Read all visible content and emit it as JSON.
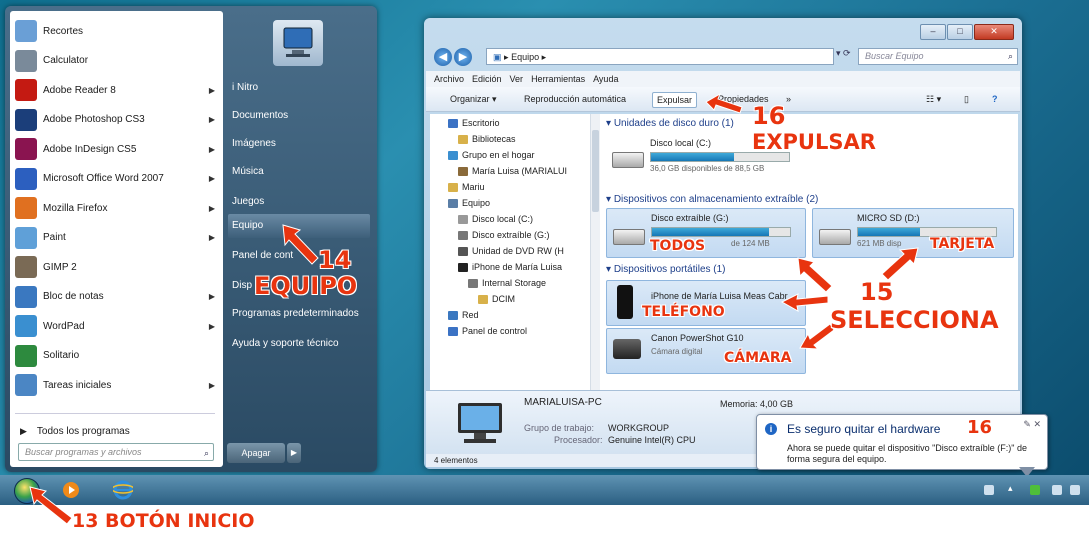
{
  "start_menu": {
    "programs": [
      {
        "label": "Recortes",
        "icon": "scissors-icon",
        "color": "#6a9fd6",
        "arrow": false
      },
      {
        "label": "Calculator",
        "icon": "calculator-icon",
        "color": "#7a8a9a",
        "arrow": false
      },
      {
        "label": "Adobe Reader 8",
        "icon": "adobe-reader-icon",
        "color": "#c41a12",
        "arrow": true
      },
      {
        "label": "Adobe Photoshop CS3",
        "icon": "photoshop-icon",
        "color": "#1b3e7a",
        "arrow": true
      },
      {
        "label": "Adobe InDesign CS5",
        "icon": "indesign-icon",
        "color": "#8a1450",
        "arrow": true
      },
      {
        "label": "Microsoft Office Word 2007",
        "icon": "word-icon",
        "color": "#2c5fbf",
        "arrow": true
      },
      {
        "label": "Mozilla Firefox",
        "icon": "firefox-icon",
        "color": "#e07020",
        "arrow": true
      },
      {
        "label": "Paint",
        "icon": "paint-icon",
        "color": "#5fa0d8",
        "arrow": true
      },
      {
        "label": "GIMP 2",
        "icon": "gimp-icon",
        "color": "#7a6a55",
        "arrow": false
      },
      {
        "label": "Bloc de notas",
        "icon": "notepad-icon",
        "color": "#3a78c0",
        "arrow": true
      },
      {
        "label": "WordPad",
        "icon": "wordpad-icon",
        "color": "#3a8fd0",
        "arrow": true
      },
      {
        "label": "Solitario",
        "icon": "solitaire-icon",
        "color": "#2d8a3e",
        "arrow": false
      },
      {
        "label": "Tareas iniciales",
        "icon": "getting-started-icon",
        "color": "#4b86c4",
        "arrow": true
      }
    ],
    "all_programs": "Todos los programas",
    "search_placeholder": "Buscar programas y archivos",
    "right_items": [
      "i Nitro",
      "Documentos",
      "Imágenes",
      "Música",
      "Juegos",
      "Equipo",
      "Panel de control",
      "Dispositivos e impresoras",
      "Programas predeterminados",
      "Ayuda y soporte técnico"
    ],
    "right_items_visible": [
      "i Nitro",
      "Documentos",
      "Imágenes",
      "Música",
      "Juegos",
      "Equipo",
      "Panel de cont",
      "Disp",
      "Programas predeterminados",
      "Ayuda y soporte técnico"
    ],
    "selected_right_index": 5,
    "shutdown_label": "Apagar"
  },
  "explorer": {
    "address": "Equipo",
    "search_placeholder": "Buscar Equipo",
    "menu": [
      "Archivo",
      "Edición",
      "Ver",
      "Herramientas",
      "Ayuda"
    ],
    "toolbar": {
      "organize": "Organizar",
      "autoplay": "Reproducción automática",
      "eject": "Expulsar",
      "properties": "Propiedades"
    },
    "nav": [
      {
        "label": "Escritorio",
        "color": "#3b72c4",
        "indent": 0
      },
      {
        "label": "Bibliotecas",
        "color": "#d8b14a",
        "indent": 1
      },
      {
        "label": "Grupo en el hogar",
        "color": "#3a8fd0",
        "indent": 0
      },
      {
        "label": "María Luisa (MARIALUI",
        "color": "#8a6a3a",
        "indent": 1
      },
      {
        "label": "Mariu",
        "color": "#d8b14a",
        "indent": 0
      },
      {
        "label": "Equipo",
        "color": "#5a7ea6",
        "indent": 0
      },
      {
        "label": "Disco local (C:)",
        "color": "#999999",
        "indent": 1
      },
      {
        "label": "Disco extraíble (G:)",
        "color": "#777777",
        "indent": 1
      },
      {
        "label": "Unidad de DVD RW (H",
        "color": "#555555",
        "indent": 1
      },
      {
        "label": "iPhone de María Luisa",
        "color": "#222222",
        "indent": 1
      },
      {
        "label": "Internal Storage",
        "color": "#777777",
        "indent": 2
      },
      {
        "label": "DCIM",
        "color": "#d8b14a",
        "indent": 3
      },
      {
        "label": "Red",
        "color": "#3a78c0",
        "indent": 0
      },
      {
        "label": "Panel de control",
        "color": "#3b72c4",
        "indent": 0
      }
    ],
    "groups": {
      "hdd": "Unidades de disco duro (1)",
      "removable": "Dispositivos con almacenamiento extraíble (2)",
      "portable": "Dispositivos portátiles (1)"
    },
    "drives": {
      "local": {
        "name": "Disco local (C:)",
        "sub": "36,0 GB disponibles de 88,5 GB",
        "fill": 0.6
      },
      "removable_g": {
        "name": "Disco extraíble (G:)",
        "sub": "de 124 MB",
        "fill": 0.85
      },
      "micro_sd": {
        "name": "MICRO SD (D:)",
        "sub": "621 MB disp",
        "fill": 0.45
      },
      "iphone": {
        "name": "iPhone de María Luisa Meas Cabr"
      },
      "camera": {
        "name": "Canon PowerShot G10",
        "sub": "Cámara digital"
      }
    },
    "details": {
      "pc_name": "MARIALUISA-PC",
      "memory": "Memoria: 4,00 GB",
      "workgroup_label": "Grupo de trabajo:",
      "workgroup": "WORKGROUP",
      "processor_label": "Procesador:",
      "processor": "Genuine Intel(R) CPU"
    },
    "status": "4 elementos"
  },
  "balloon": {
    "title": "Es seguro quitar el hardware",
    "body": "Ahora se puede quitar el dispositivo \"Disco extraíble (F:)\" de forma segura del equipo."
  },
  "annotations": {
    "a16_number": "16",
    "a16_text": "EXPULSAR",
    "a14_number": "14",
    "a14_text": "EQUIPO",
    "a15_number": "15",
    "a15_text": "SELECCIONA",
    "todos": "TODOS",
    "tarjeta": "TARJETA",
    "telefono": "TELÉFONO",
    "camara": "CÁMARA",
    "balloon_16": "16",
    "a13": "13 BOTÓN INICIO"
  },
  "colors": {
    "annotation": "#e8340f",
    "accent": "#1e3f8a"
  }
}
